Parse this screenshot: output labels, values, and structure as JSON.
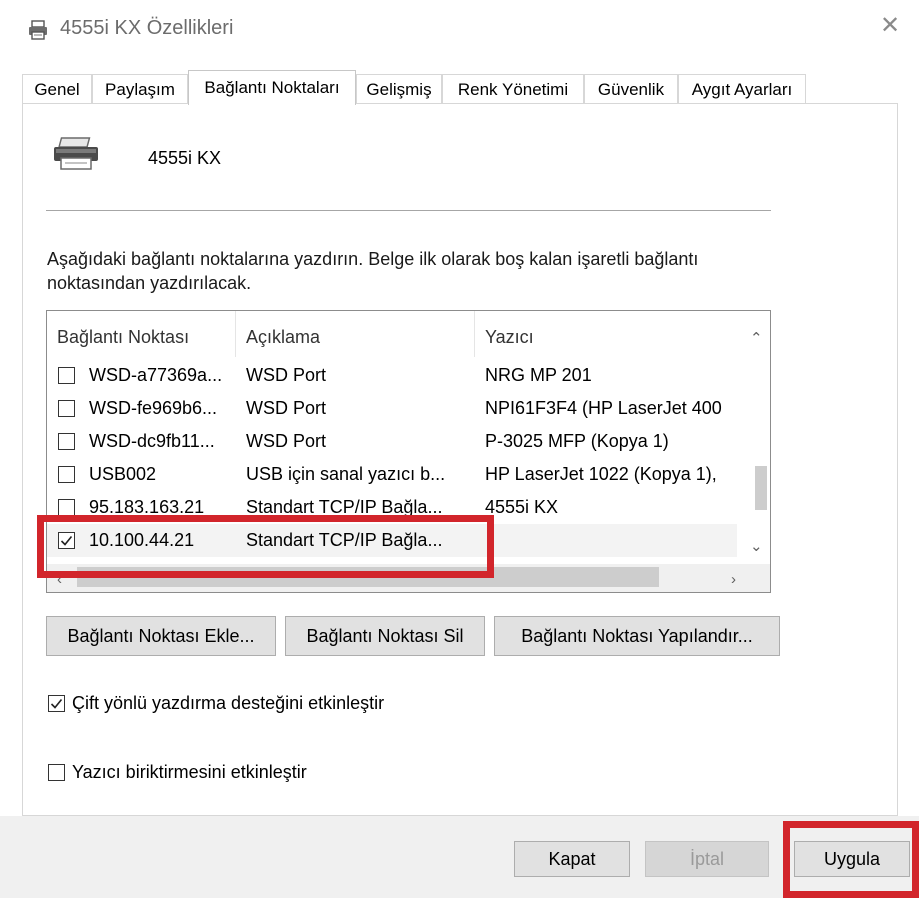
{
  "window": {
    "title": "4555i KX Özellikleri",
    "close_glyph": "✕",
    "icon": "printer-icon"
  },
  "tabs": [
    {
      "label": "Genel"
    },
    {
      "label": "Paylaşım"
    },
    {
      "label": "Bağlantı Noktaları",
      "selected": true
    },
    {
      "label": "Gelişmiş"
    },
    {
      "label": "Renk Yönetimi"
    },
    {
      "label": "Güvenlik"
    },
    {
      "label": "Aygıt Ayarları"
    }
  ],
  "printer": {
    "name": "4555i KX",
    "icon": "printer-icon"
  },
  "description": "Aşağıdaki bağlantı noktalarına yazdırın. Belge ilk olarak boş kalan işaretli bağlantı noktasından yazdırılacak.",
  "ports_table": {
    "headers": [
      "Bağlantı Noktası",
      "Açıklama",
      "Yazıcı"
    ],
    "rows": [
      {
        "port": "WSD-a77369a...",
        "desc": "WSD Port",
        "printer": "NRG MP 201",
        "checked": false
      },
      {
        "port": "WSD-fe969b6...",
        "desc": "WSD Port",
        "printer": "NPI61F3F4 (HP LaserJet 400",
        "checked": false
      },
      {
        "port": "WSD-dc9fb11...",
        "desc": "WSD Port",
        "printer": "P-3025 MFP (Kopya 1)",
        "checked": false
      },
      {
        "port": "USB002",
        "desc": "USB için sanal yazıcı b...",
        "printer": "HP LaserJet 1022 (Kopya 1),",
        "checked": false
      },
      {
        "port": "95.183.163.21",
        "desc": "Standart TCP/IP Bağla...",
        "printer": "4555i KX",
        "checked": false
      },
      {
        "port": "10.100.44.21",
        "desc": "Standart TCP/IP Bağla...",
        "printer": "",
        "checked": true
      }
    ]
  },
  "port_buttons": {
    "add": "Bağlantı Noktası Ekle...",
    "delete": "Bağlantı Noktası Sil",
    "configure": "Bağlantı Noktası Yapılandır..."
  },
  "options": {
    "bidirectional": {
      "label": "Çift yönlü yazdırma desteğini etkinleştir",
      "checked": true
    },
    "pooling": {
      "label": "Yazıcı biriktirmesini etkinleştir",
      "checked": false
    }
  },
  "footer_buttons": {
    "close": "Kapat",
    "cancel": "İptal",
    "apply": "Uygula"
  },
  "colors": {
    "highlight": "#d2252b",
    "footer_bg": "#f0f0f0",
    "button_bg": "#e1e1e1"
  }
}
